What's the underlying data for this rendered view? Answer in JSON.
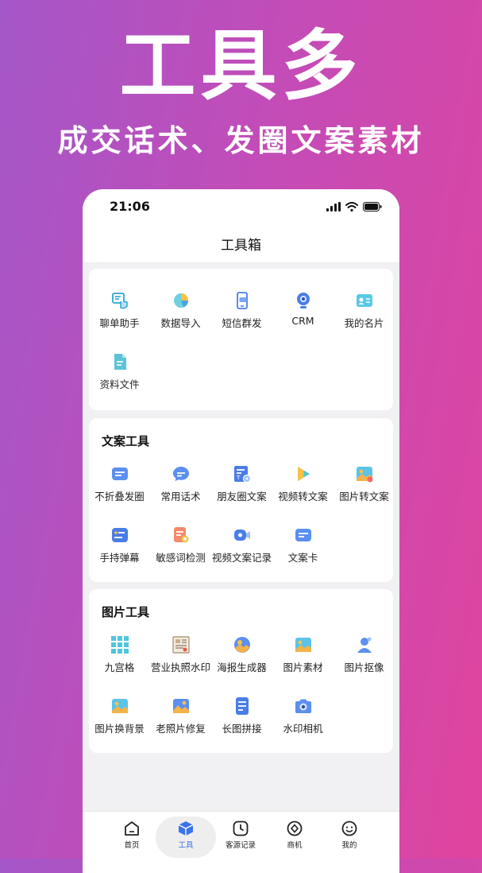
{
  "hero": {
    "title": "工具多",
    "subtitle": "成交话术、发圈文案素材"
  },
  "status_bar": {
    "time": "21:06"
  },
  "nav": {
    "title": "工具箱"
  },
  "sections": [
    {
      "title": "",
      "items": [
        {
          "label": "聊单助手",
          "icon": "chat-hand-icon"
        },
        {
          "label": "数据导入",
          "icon": "pie-chart-icon"
        },
        {
          "label": "短信群发",
          "icon": "phone-sms-icon"
        },
        {
          "label": "CRM",
          "icon": "webcam-icon"
        },
        {
          "label": "我的名片",
          "icon": "id-card-icon"
        },
        {
          "label": "资料文件",
          "icon": "document-icon"
        }
      ]
    },
    {
      "title": "文案工具",
      "items": [
        {
          "label": "不折叠发圈",
          "icon": "message-box-icon"
        },
        {
          "label": "常用话术",
          "icon": "speech-bubble-icon"
        },
        {
          "label": "朋友圈文案",
          "icon": "text-settings-icon"
        },
        {
          "label": "视频转文案",
          "icon": "play-icon"
        },
        {
          "label": "图片转文案",
          "icon": "image-text-icon"
        },
        {
          "label": "手持弹幕",
          "icon": "danmaku-icon"
        },
        {
          "label": "敏感词检测",
          "icon": "sensitive-check-icon"
        },
        {
          "label": "视频文案记录",
          "icon": "video-record-icon"
        },
        {
          "label": "文案卡",
          "icon": "card-icon"
        }
      ]
    },
    {
      "title": "图片工具",
      "items": [
        {
          "label": "九宫格",
          "icon": "grid-icon"
        },
        {
          "label": "营业执照水印",
          "icon": "license-icon"
        },
        {
          "label": "海报生成器",
          "icon": "poster-icon"
        },
        {
          "label": "图片素材",
          "icon": "picture-icon"
        },
        {
          "label": "图片抠像",
          "icon": "portrait-cutout-icon"
        },
        {
          "label": "图片换背景",
          "icon": "picture-swap-icon"
        },
        {
          "label": "老照片修复",
          "icon": "photo-repair-icon"
        },
        {
          "label": "长图拼接",
          "icon": "long-image-icon"
        },
        {
          "label": "水印相机",
          "icon": "camera-icon"
        }
      ]
    }
  ],
  "tabs": [
    {
      "label": "首页",
      "icon": "home-icon"
    },
    {
      "label": "工具",
      "icon": "toolbox-icon",
      "active": true
    },
    {
      "label": "客源记录",
      "icon": "clock-icon"
    },
    {
      "label": "商机",
      "icon": "diamond-icon"
    },
    {
      "label": "我的",
      "icon": "smiley-icon"
    }
  ],
  "colors": {
    "accent": "#3b73e8",
    "background_gradient_start": "#a457c8",
    "background_gradient_end": "#e0449e"
  }
}
